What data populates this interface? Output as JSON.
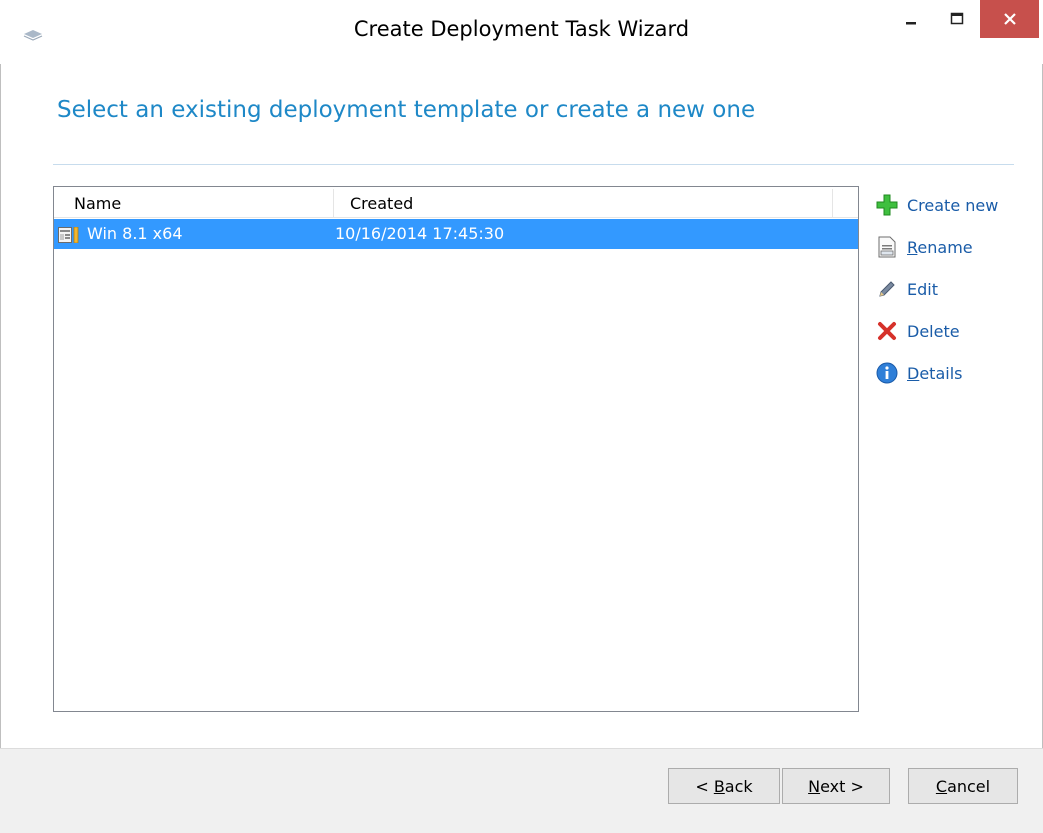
{
  "window": {
    "title": "Create Deployment Task Wizard",
    "accent": "#1e88c7",
    "close_button_color": "#c7504c"
  },
  "page": {
    "heading": "Select an existing deployment template or create a new one"
  },
  "templates_list": {
    "columns": [
      "Name",
      "Created"
    ],
    "rows": [
      {
        "name": "Win 8.1 x64",
        "created": "10/16/2014 17:45:30",
        "selected": true,
        "icon": "template-icon"
      }
    ],
    "selection_color": "#3399ff"
  },
  "actions": [
    {
      "label": "Create new",
      "icon": "add-icon",
      "color": "#22b14c"
    },
    {
      "label": "Rename",
      "icon": "rename-icon"
    },
    {
      "label": "Edit",
      "icon": "pencil-icon"
    },
    {
      "label": "Delete",
      "icon": "delete-icon",
      "color": "#d6312a"
    },
    {
      "label": "Details",
      "icon": "info-icon",
      "color": "#2778d6"
    }
  ],
  "footer": {
    "back_prefix": "< ",
    "back_mnemonic": "B",
    "back_rest": "ack",
    "next_mnemonic": "N",
    "next_rest": "ext >",
    "cancel_mnemonic": "C",
    "cancel_rest": "ancel"
  }
}
